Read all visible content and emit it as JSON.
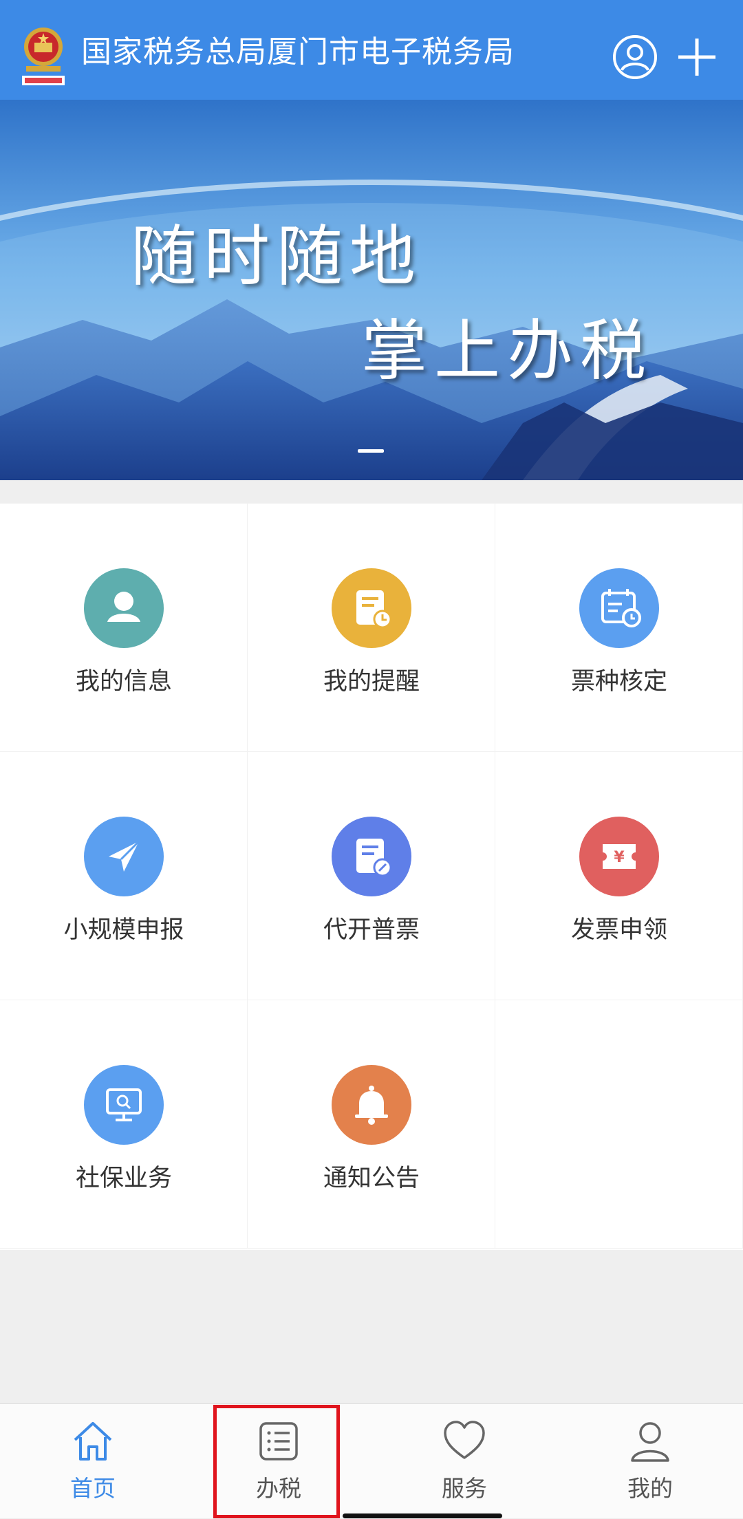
{
  "header": {
    "title": "国家税务总局厦门市电子税务局",
    "logo_icon": "tax-emblem-icon",
    "user_icon": "user-circle-icon",
    "add_icon": "plus-icon",
    "background": "#3d8ae6"
  },
  "banner": {
    "line1": "随时随地",
    "line2": "掌上办税",
    "active_slide": 1,
    "slide_count": 1
  },
  "menu": [
    {
      "label": "我的信息",
      "icon": "person-icon",
      "color": "#5eaeae"
    },
    {
      "label": "我的提醒",
      "icon": "reminder-doc-icon",
      "color": "#e9b23b"
    },
    {
      "label": "票种核定",
      "icon": "calendar-clock-icon",
      "color": "#5b9ff0"
    },
    {
      "label": "小规模申报",
      "icon": "paper-plane-icon",
      "color": "#5b9ff0"
    },
    {
      "label": "代开普票",
      "icon": "doc-edit-icon",
      "color": "#5f7fe8"
    },
    {
      "label": "发票申领",
      "icon": "yen-ticket-icon",
      "color": "#e0605f"
    },
    {
      "label": "社保业务",
      "icon": "monitor-search-icon",
      "color": "#5b9ff0"
    },
    {
      "label": "通知公告",
      "icon": "bell-icon",
      "color": "#e3814c"
    }
  ],
  "tabbar": {
    "tabs": [
      {
        "label": "首页",
        "icon": "home-icon",
        "active": true
      },
      {
        "label": "办税",
        "icon": "list-icon",
        "active": false
      },
      {
        "label": "服务",
        "icon": "heart-icon",
        "active": false
      },
      {
        "label": "我的",
        "icon": "person-outline-icon",
        "active": false
      }
    ],
    "active_color": "#3d8ae6"
  }
}
